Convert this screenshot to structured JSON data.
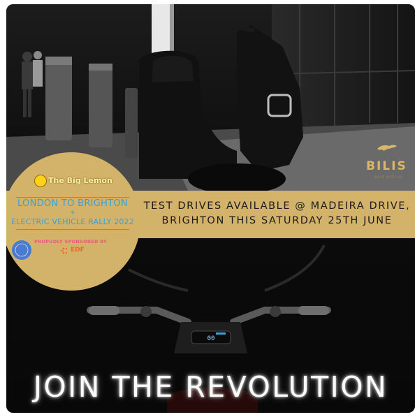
{
  "promo": {
    "band_line1": "TEST DRIVES AVAILABLE @ MADEIRA DRIVE,",
    "band_line2": "BRIGHTON THIS SATURDAY 25TH JUNE",
    "headline": "JOIN THE REVOLUTION"
  },
  "event_badge": {
    "organizer": "The Big Lemon",
    "route": "LONDON TO BRIGHTON",
    "plus": "+",
    "rally": "ELECTRIC VEHICLE RALLY 2022",
    "sponsor_label": "PROPUDLY SPONSORED BY",
    "sponsor_name": "EDF"
  },
  "brand": {
    "name": "BILIS",
    "tagline": "MOVE WITH US"
  },
  "colors": {
    "gold": "#d3b36a",
    "blue": "#3aa0d8",
    "background": "#0e0e0e"
  },
  "icons": {
    "organizer_logo": "lemon-bus-icon",
    "sponsor_logo": "edf-spark-icon",
    "brand_logo": "leaping-cat-icon"
  }
}
